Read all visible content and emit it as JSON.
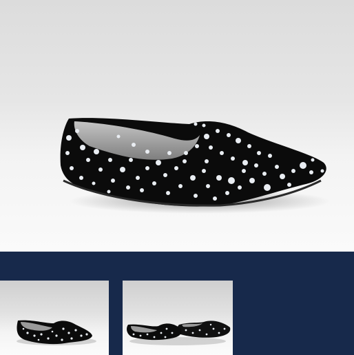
{
  "product": {
    "main_image": {
      "icon": "shoe-image",
      "colors": {
        "shoe": "#0b0b0b",
        "dots": "#e9edf2",
        "lining": "#9a9a9a"
      }
    },
    "thumbnails": [
      {
        "icon": "shoe-thumbnail-side-view"
      },
      {
        "icon": "shoe-thumbnail-pair-view"
      }
    ]
  },
  "theme": {
    "thumbnail_bar_color": "#17294b",
    "background": "#ffffff"
  }
}
